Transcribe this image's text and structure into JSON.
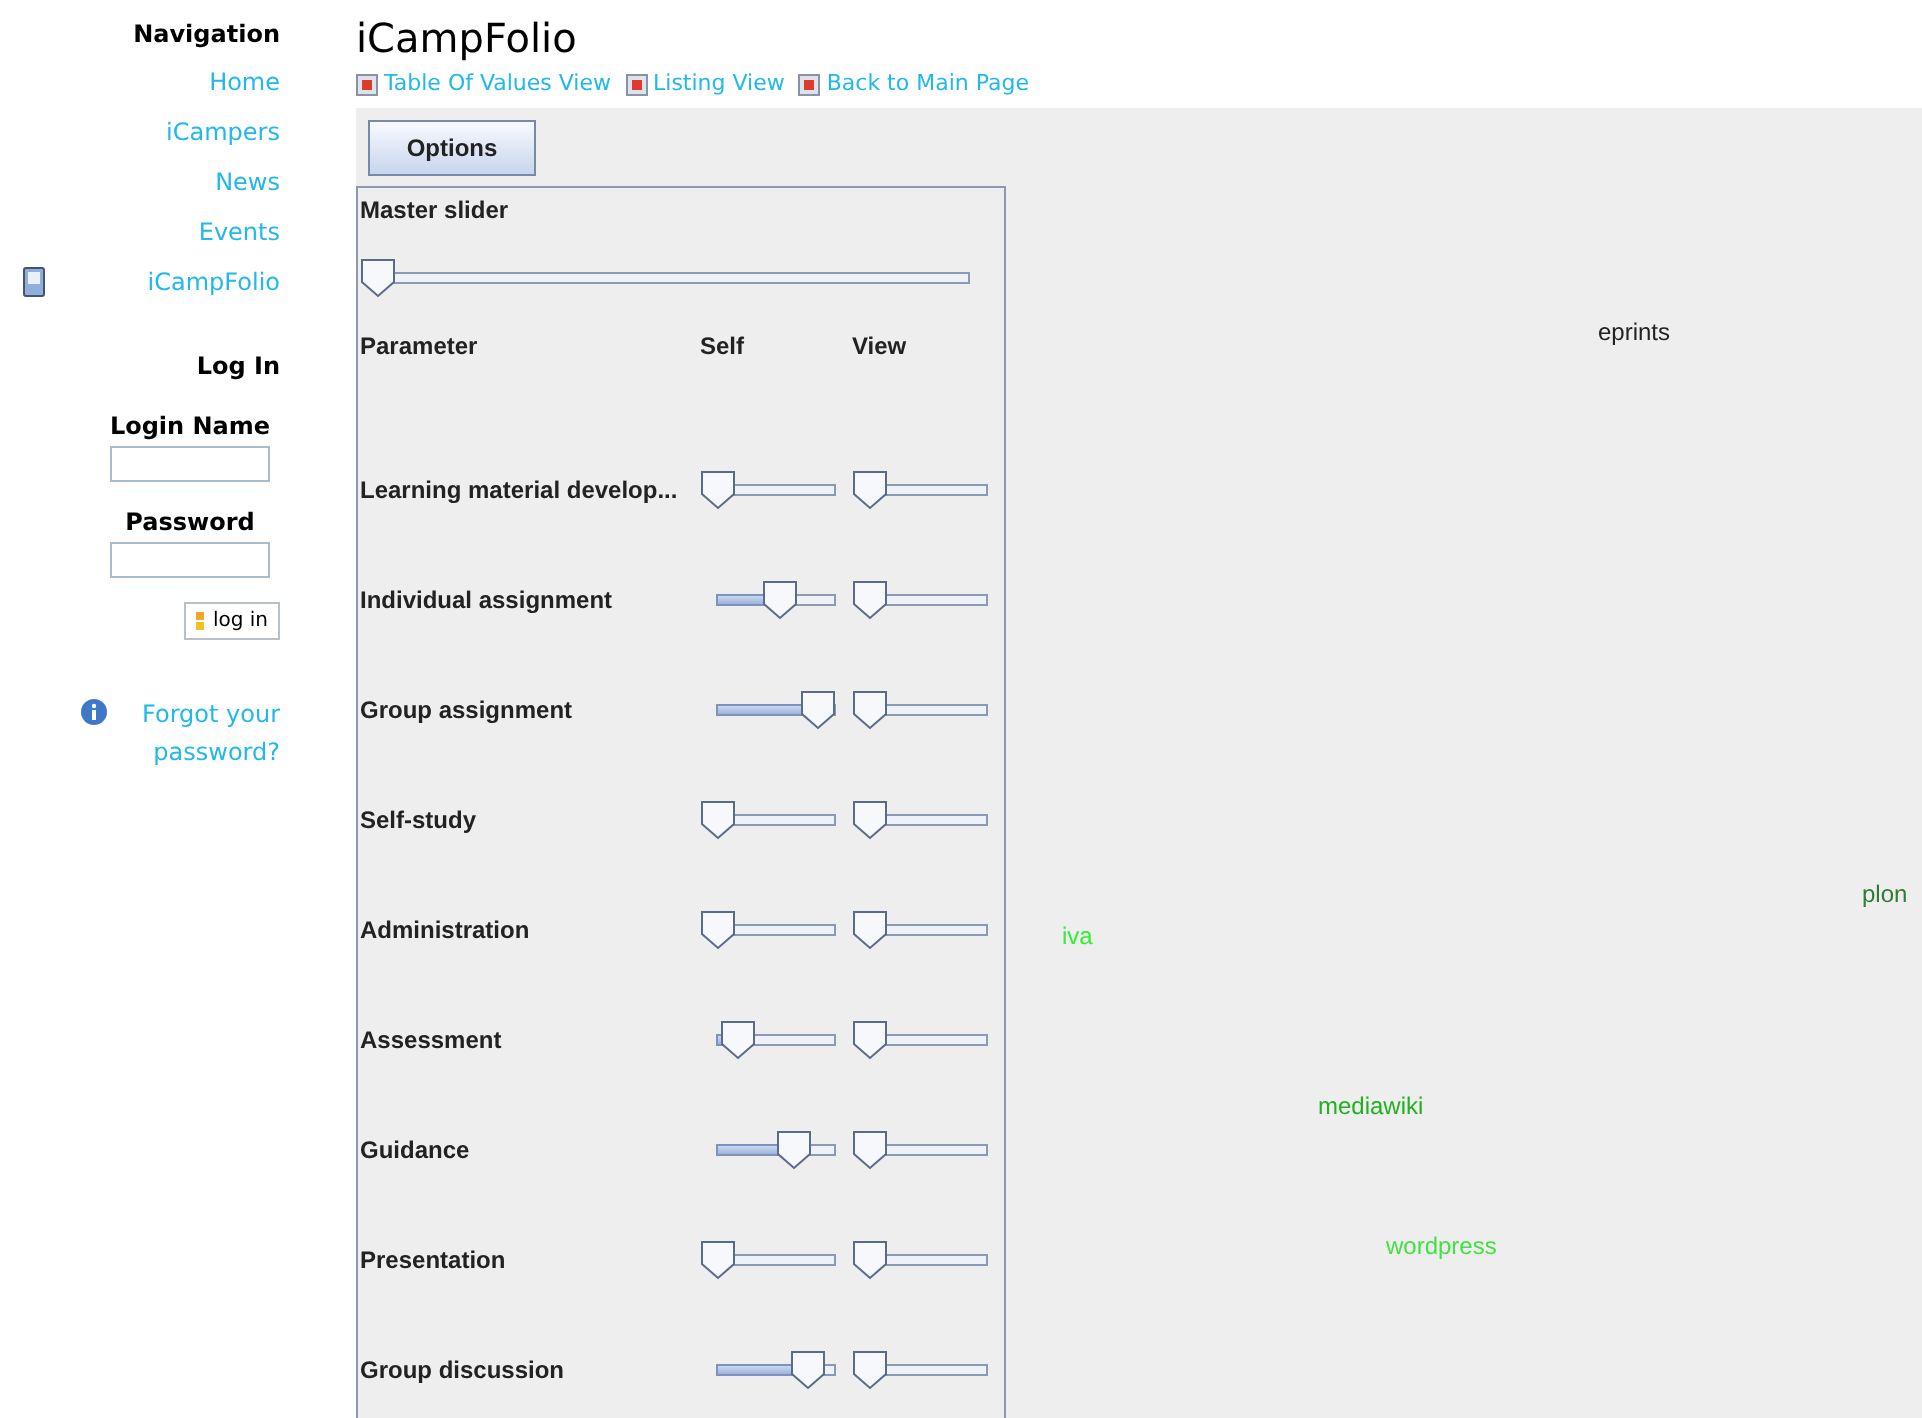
{
  "sidebar": {
    "title": "Navigation",
    "items": [
      {
        "label": "Home",
        "kind": "plain"
      },
      {
        "label": "iCampers",
        "kind": "plain"
      },
      {
        "label": "News",
        "kind": "plain"
      },
      {
        "label": "Events",
        "kind": "plain"
      },
      {
        "label": "iCampFolio",
        "kind": "current"
      }
    ],
    "login": {
      "title": "Log In",
      "name_label": "Login Name",
      "password_label": "Password",
      "button": "log in",
      "forgot": "Forgot your password?"
    }
  },
  "page": {
    "title": "iCampFolio",
    "links": [
      "Table Of Values View",
      "Listing View",
      "Back to Main Page"
    ]
  },
  "applet": {
    "options_button": "Options",
    "master_label": "Master slider",
    "master": {
      "level": 0
    },
    "columns": [
      "Parameter",
      "Self",
      "View"
    ],
    "parameters": [
      {
        "name": "Learning material develop...",
        "self": {
          "level": 0
        },
        "view": {
          "level": 0
        }
      },
      {
        "name": "Individual assignment",
        "self": {
          "level": 0.62
        },
        "view": {
          "level": 0
        }
      },
      {
        "name": "Group assignment",
        "self": {
          "level": 1
        },
        "view": {
          "level": 0
        }
      },
      {
        "name": "Self-study",
        "self": {
          "level": 0
        },
        "view": {
          "level": 0
        }
      },
      {
        "name": "Administration",
        "self": {
          "level": 0
        },
        "view": {
          "level": 0
        }
      },
      {
        "name": "Assessment",
        "self": {
          "level": 0.2
        },
        "view": {
          "level": 0
        }
      },
      {
        "name": "Guidance",
        "self": {
          "level": 0.75
        },
        "view": {
          "level": 0
        }
      },
      {
        "name": "Presentation",
        "self": {
          "level": 0
        },
        "view": {
          "level": 0
        }
      },
      {
        "name": "Group discussion",
        "self": {
          "level": 0.9
        },
        "view": {
          "level": 0
        }
      }
    ],
    "tools": [
      {
        "label": "eprints",
        "color": "#222222"
      },
      {
        "label": "plon",
        "color": "#2e7d32"
      },
      {
        "label": "iva",
        "color": "#33ee33"
      },
      {
        "label": "mediawiki",
        "color": "#22b022"
      },
      {
        "label": "wordpress",
        "color": "#44e044"
      }
    ]
  }
}
